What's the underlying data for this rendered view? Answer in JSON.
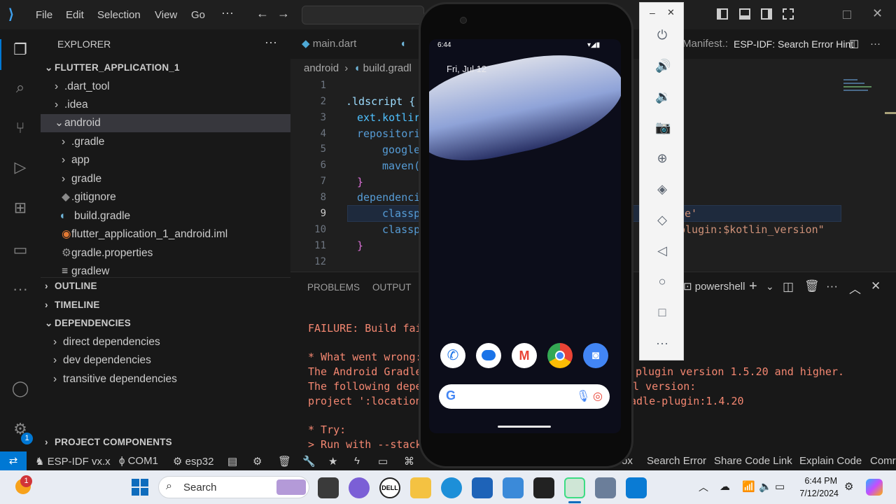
{
  "menu": [
    "File",
    "Edit",
    "Selection",
    "View",
    "Go"
  ],
  "explorer": {
    "title": "EXPLORER",
    "project": "FLUTTER_APPLICATION_1",
    "items": [
      ".dart_tool",
      ".idea",
      "android",
      ".gradle",
      "app",
      "gradle",
      ".gitignore",
      "build.gradle",
      "flutter_application_1_android.iml",
      "gradle.properties",
      "gradlew"
    ],
    "sections": [
      "OUTLINE",
      "TIMELINE",
      "DEPENDENCIES",
      "PROJECT COMPONENTS"
    ],
    "deps": [
      "direct dependencies",
      "dev dependencies",
      "transitive dependencies"
    ]
  },
  "tabs": [
    "main.dart",
    "Manifest.:",
    "ESP-IDF: Search Error Hint"
  ],
  "breadcrumb": [
    "android",
    "build.gradl"
  ],
  "code": {
    "lines": [
      "1",
      "2",
      "3",
      "4",
      "5",
      "6",
      "7",
      "8",
      "9",
      "10",
      "11",
      "12"
    ],
    "l2": ".ldscript {",
    "l3": "ext.kotlir",
    "l4": "repositori",
    "l5": "google",
    "l6": "maven(",
    "l7": "}",
    "l8": "dependenci",
    "l9": "classp",
    "l9r": "e'",
    "l10": "classp",
    "l10r": "plugin:$kotlin_version\"",
    "l11": "}"
  },
  "panel": {
    "tabs": [
      "PROBLEMS",
      "OUTPUT"
    ],
    "shell": "powershell",
    "t1": "FAILURE: Build fai",
    "t2": "* What went wrong:",
    "t3": "The Android Gradle",
    "t3r": "plugin version 1.5.20 and higher.",
    "t4": "The following depe",
    "t4r": "l version:",
    "t5": "project ':location",
    "t5r": "adle-plugin:1.4.20",
    "t6": "* Try:",
    "t7": "> Run with --stack"
  },
  "statusbar": {
    "idf": "ESP-IDF vx.x",
    "port": "COM1",
    "chip": "esp32",
    "right": [
      "ox",
      "Search Error",
      "Share Code Link",
      "Explain Code",
      "Comr"
    ],
    "badge": "1"
  },
  "phone": {
    "time": "6:44",
    "date": "Fri, Jul 12"
  },
  "taskbar": {
    "search": "Search",
    "time": "6:44 PM",
    "date": "7/12/2024",
    "notif": "1"
  },
  "colors": {
    "accent": "#007acc",
    "error": "#f48771",
    "keyword": "#569cd6",
    "brace": "#ffd700"
  }
}
